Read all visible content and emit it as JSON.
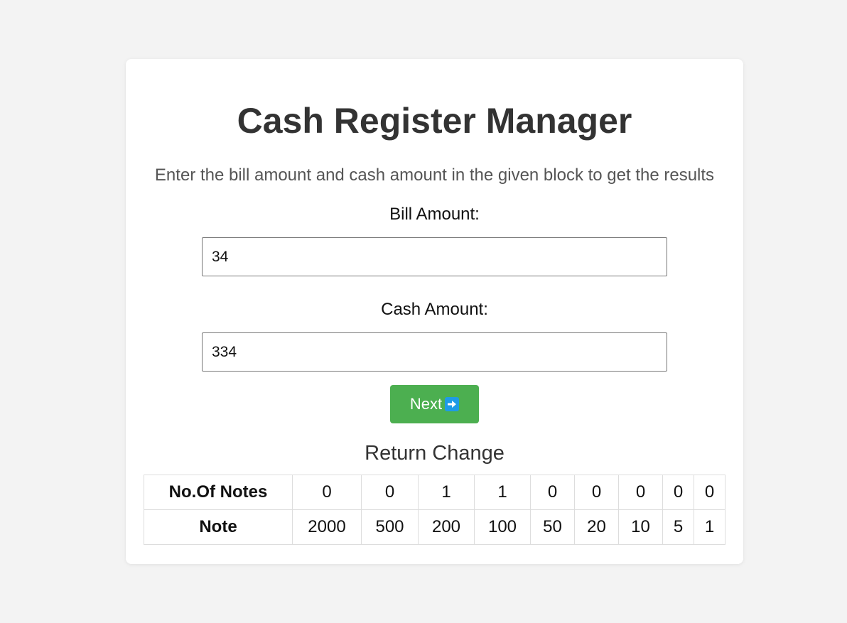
{
  "app": {
    "title": "Cash Register Manager",
    "subtitle": "Enter the bill amount and cash amount in the given block to get the results"
  },
  "bill": {
    "label": "Bill Amount:",
    "value": "34"
  },
  "cash": {
    "label": "Cash Amount:",
    "value": "334"
  },
  "next_button": {
    "label": "Next",
    "icon": "right-arrow-icon",
    "color": "#4caf50"
  },
  "result": {
    "title": "Return Change",
    "count_header": "No.Of Notes",
    "note_header": "Note",
    "counts": [
      "0",
      "0",
      "1",
      "1",
      "0",
      "0",
      "0",
      "0",
      "0"
    ],
    "notes": [
      "2000",
      "500",
      "200",
      "100",
      "50",
      "20",
      "10",
      "5",
      "1"
    ]
  }
}
